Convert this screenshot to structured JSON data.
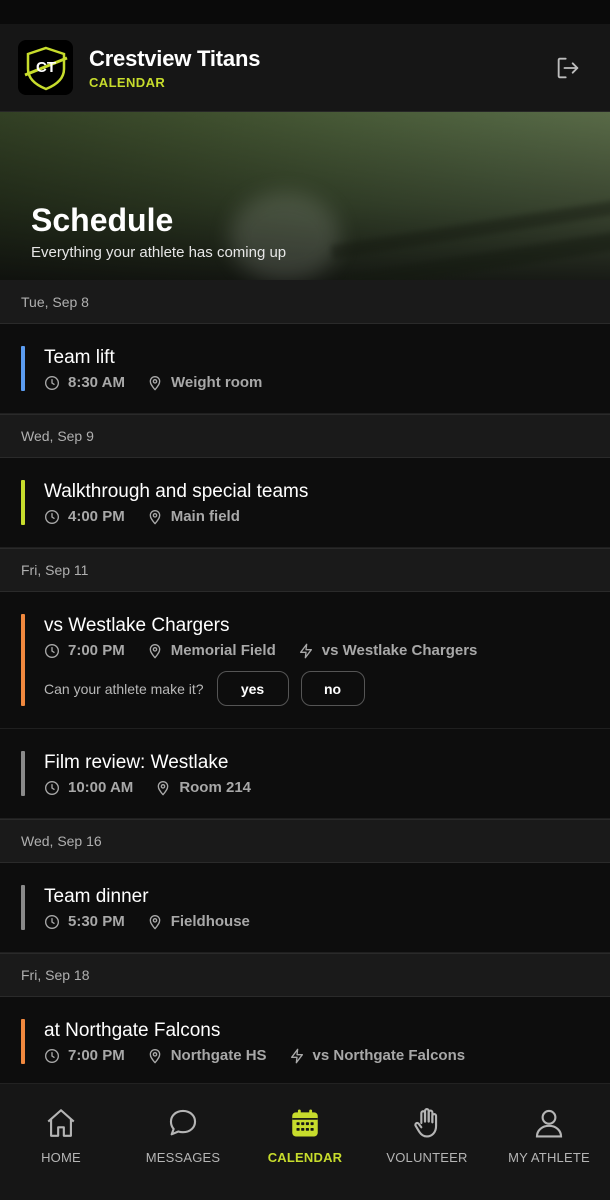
{
  "header": {
    "logo_text": "CT",
    "team_name": "Crestview Titans",
    "section": "CALENDAR"
  },
  "hero": {
    "title": "Schedule",
    "subtitle": "Everything your athlete has coming up"
  },
  "colors": {
    "accent": "#c7dc2c",
    "bar_blue": "#5b9cf0",
    "bar_lime": "#c7dc2c",
    "bar_orange": "#f0883e",
    "bar_gray": "#8a8a8a"
  },
  "days": [
    {
      "date": "Tue, Sep 8",
      "events": [
        {
          "title": "Team lift",
          "time": "8:30 AM",
          "location": "Weight room",
          "bar": "blue"
        }
      ]
    },
    {
      "date": "Wed, Sep 9",
      "events": [
        {
          "title": "Walkthrough and special teams",
          "time": "4:00 PM",
          "location": "Main field",
          "bar": "lime"
        }
      ]
    },
    {
      "date": "Fri, Sep 11",
      "events": [
        {
          "title": "vs Westlake Chargers",
          "time": "7:00 PM",
          "location": "Memorial Field",
          "opponent": "vs Westlake Chargers",
          "bar": "orange",
          "rsvp": {
            "question": "Can your athlete make it?",
            "yes": "yes",
            "no": "no"
          }
        },
        {
          "title": "Film review: Westlake",
          "time": "10:00 AM",
          "location": "Room 214",
          "bar": "gray"
        }
      ]
    },
    {
      "date": "Wed, Sep 16",
      "events": [
        {
          "title": "Team dinner",
          "time": "5:30 PM",
          "location": "Fieldhouse",
          "bar": "gray"
        }
      ]
    },
    {
      "date": "Fri, Sep 18",
      "events": [
        {
          "title": "at Northgate Falcons",
          "time": "7:00 PM",
          "location": "Northgate HS",
          "opponent": "vs Northgate Falcons",
          "bar": "orange"
        }
      ]
    }
  ],
  "tabs": [
    {
      "label": "HOME",
      "icon": "home-icon",
      "active": false
    },
    {
      "label": "MESSAGES",
      "icon": "chat-bubble-icon",
      "active": false
    },
    {
      "label": "CALENDAR",
      "icon": "calendar-icon",
      "active": true
    },
    {
      "label": "VOLUNTEER",
      "icon": "hand-icon",
      "active": false
    },
    {
      "label": "MY ATHLETE",
      "icon": "person-icon",
      "active": false
    }
  ]
}
